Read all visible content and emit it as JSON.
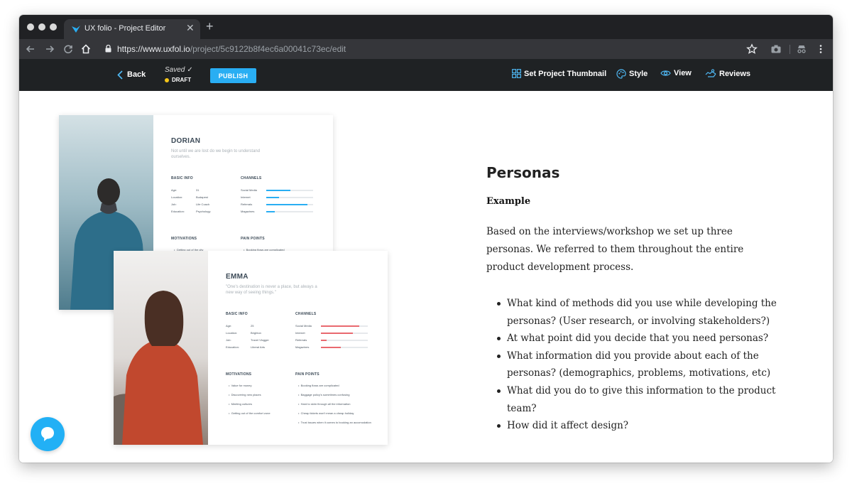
{
  "browser": {
    "tab_title": "UX folio - Project Editor",
    "url_scheme": "https://",
    "url_host": "www.uxfol.io",
    "url_path": "/project/5c9122b8f4ec6a00041c73ec/edit"
  },
  "editor": {
    "back_label": "Back",
    "saved_label": "Saved",
    "draft_label": "DRAFT",
    "publish_label": "PUBLISH",
    "nav": [
      {
        "label": "Set Project Thumbnail",
        "icon": "grid-icon"
      },
      {
        "label": "Style",
        "icon": "palette-icon"
      },
      {
        "label": "View",
        "icon": "eye-icon"
      },
      {
        "label": "Reviews",
        "icon": "handshake-icon"
      }
    ],
    "accent_color": "#29aef3"
  },
  "personas": [
    {
      "name": "DORIAN",
      "quote": "Not until we are lost do we begin to understand ourselves.",
      "basic_info_title": "BASIC INFO",
      "basic_info": [
        {
          "label": "Age:",
          "value": "31"
        },
        {
          "label": "Location:",
          "value": "Budapest"
        },
        {
          "label": "Job:",
          "value": "Life Coach"
        },
        {
          "label": "Education:",
          "value": "Psychology"
        }
      ],
      "channels_title": "CHANNELS",
      "channel_color": "#29aef3",
      "channels": [
        {
          "label": "Social Media",
          "level": 0.52
        },
        {
          "label": "Internet",
          "level": 0.28
        },
        {
          "label": "Referrals",
          "level": 0.88
        },
        {
          "label": "Magazines",
          "level": 0.18
        }
      ],
      "motivations_title": "MOTIVATIONS",
      "motivations": [
        "Getting out of the city"
      ],
      "pain_points_title": "PAIN POINTS",
      "pain_points": [
        "Booking flows are complicated"
      ]
    },
    {
      "name": "EMMA",
      "quote": "\"One's destination is never a place, but always a new way of seeing things.\"",
      "basic_info_title": "BASIC INFO",
      "basic_info": [
        {
          "label": "Age:",
          "value": "25"
        },
        {
          "label": "Location:",
          "value": "Brighton"
        },
        {
          "label": "Job:",
          "value": "Travel Vlogger"
        },
        {
          "label": "Education:",
          "value": "Liberal Arts"
        }
      ],
      "channels_title": "CHANNELS",
      "channel_color": "#e9696f",
      "channels": [
        {
          "label": "Social Media",
          "level": 0.82
        },
        {
          "label": "Internet",
          "level": 0.68
        },
        {
          "label": "Referrals",
          "level": 0.12
        },
        {
          "label": "Magazines",
          "level": 0.42
        }
      ],
      "motivations_title": "MOTIVATIONS",
      "motivations": [
        "Value for money",
        "Discovering new places",
        "Meeting cultures",
        "Getting out of the comfort zone"
      ],
      "pain_points_title": "PAIN POINTS",
      "pain_points": [
        "Booking flows are complicated",
        "Baggage policy's sometimes confusing",
        "Hard to skim through all the information",
        "Cheap tickets won't mean a cheap holiday",
        "Trust issues when it comes to booking an accomodation"
      ]
    }
  ],
  "article": {
    "heading": "Personas",
    "subheading": "Example",
    "paragraph": "Based on the interviews/workshop we set up three personas. We referred to them throughout the entire product development process.",
    "bullets": [
      "What kind of methods did you use while developing the personas? (User research, or involving stakeholders?)",
      " At what point did you decide that you need personas?",
      "What information did you provide about each of the personas? (demographics, problems, motivations, etc)",
      "What did you do to give this information to the product team?",
      " How did it affect design?"
    ]
  },
  "chat_icon": "chat-bubble-icon"
}
